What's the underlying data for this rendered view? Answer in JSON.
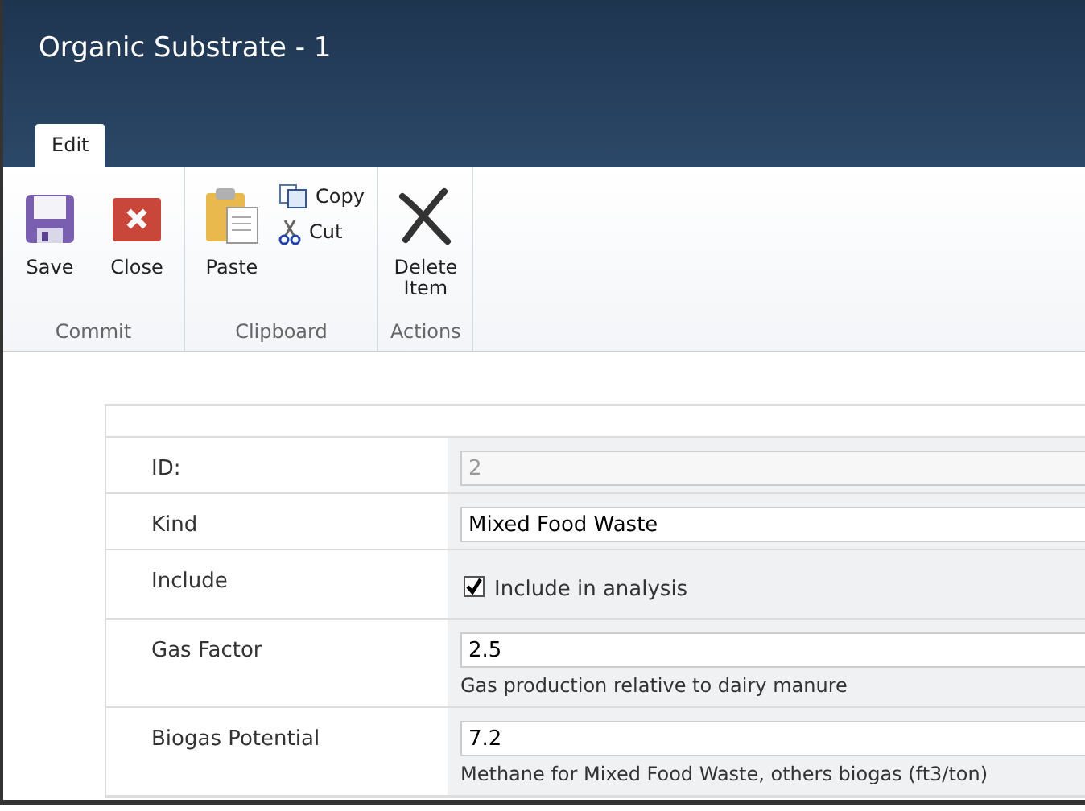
{
  "window": {
    "title": "Organic Substrate - 1"
  },
  "tabs": [
    {
      "label": "Edit",
      "selected": true
    }
  ],
  "ribbon": {
    "groups": [
      {
        "label": "Commit",
        "buttons": [
          {
            "label": "Save",
            "kind": "large"
          },
          {
            "label": "Close",
            "kind": "large"
          }
        ]
      },
      {
        "label": "Clipboard",
        "buttons": [
          {
            "label": "Paste",
            "kind": "large"
          },
          {
            "label": "Copy",
            "kind": "small"
          },
          {
            "label": "Cut",
            "kind": "small"
          }
        ]
      },
      {
        "label": "Actions",
        "buttons": [
          {
            "label": "Delete\nItem",
            "kind": "large"
          }
        ]
      }
    ]
  },
  "form": {
    "fields": [
      {
        "kind": "readonly",
        "label": "ID:",
        "value": "2"
      },
      {
        "kind": "text",
        "label": "Kind",
        "value": "Mixed Food Waste"
      },
      {
        "kind": "checkbox",
        "label": "Include",
        "option": "Include in analysis",
        "checked": true
      },
      {
        "kind": "text",
        "label": "Gas Factor",
        "value": "2.5",
        "description": "Gas production relative to dairy manure"
      },
      {
        "kind": "text",
        "label": "Biogas Potential",
        "value": "7.2",
        "description": "Methane for Mixed Food Waste, others biogas (ft3/ton)"
      }
    ]
  }
}
